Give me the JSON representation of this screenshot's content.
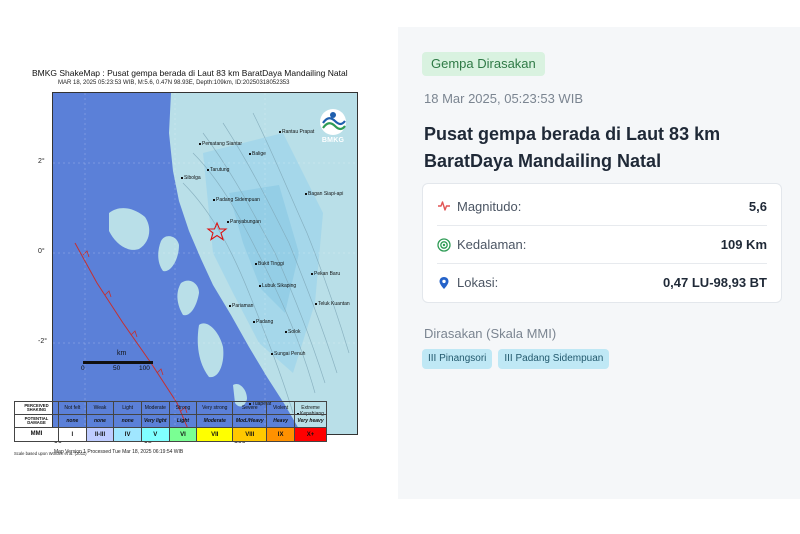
{
  "map": {
    "title": "BMKG ShakeMap : Pusat gempa berada di Laut 83 km BaratDaya Mandailing Natal",
    "subtitle": "MAR 18, 2025 05:23:53 WIB, M:5.6, 0.47N 98.93E, Depth:109km, ID:20250318052353",
    "lat_labels": [
      "2°",
      "0°",
      "-2°"
    ],
    "lon_labels": [
      "96°",
      "98°",
      "100°"
    ],
    "scale_title": "km",
    "scale_ticks": [
      "0",
      "50",
      "100"
    ],
    "logo_text": "BMKG",
    "version_note": "Map Version 1 Processed Tue Mar 18, 2025 06:19:54 WIB",
    "scale_note": "Scale based upon Worden et al. (2011)",
    "places": [
      "Pematang Siantar",
      "Balige",
      "Bagan Siapi-api",
      "Sibolga",
      "Padang Sidempuan",
      "Panyabungan",
      "Bukit Tinggi",
      "Pekan Baru",
      "Lubuk Sikaping",
      "Teluk Kuantan",
      "Padang",
      "Sungai Penuh",
      "Solok",
      "Pariaman",
      "Kepahiang",
      "Tuapejat",
      "Tarutung",
      "Rantau Prapat"
    ],
    "legend": {
      "headers": [
        "PERCEIVED SHAKING",
        "Not felt",
        "Weak",
        "Light",
        "Moderate",
        "Strong",
        "Very strong",
        "Severe",
        "Violent",
        "Extreme"
      ],
      "damage": [
        "POTENTIAL DAMAGE",
        "none",
        "none",
        "none",
        "Very light",
        "Light",
        "Moderate",
        "Mod./Heavy",
        "Heavy",
        "Very heavy"
      ],
      "mmi": [
        "MMI",
        "I",
        "II-III",
        "IV",
        "V",
        "VI",
        "VII",
        "VIII",
        "IX",
        "X+"
      ],
      "mmi_colors": [
        "#ffffff",
        "#ffffff",
        "#bfccff",
        "#a0e6ff",
        "#80ffff",
        "#7aff93",
        "#ffff00",
        "#ffc800",
        "#ff9100",
        "#ff0000",
        "#c80000"
      ]
    }
  },
  "event": {
    "badge": "Gempa Dirasakan",
    "timestamp": "18 Mar 2025, 05:23:53 WIB",
    "headline": "Pusat gempa berada di Laut 83 km BaratDaya Mandailing Natal",
    "rows": [
      {
        "label": "Magnitudo:",
        "value": "5,6",
        "icon": "activity-icon"
      },
      {
        "label": "Kedalaman:",
        "value": "109 Km",
        "icon": "target-icon"
      },
      {
        "label": "Lokasi:",
        "value": "0,47 LU-98,93 BT",
        "icon": "location-pin-icon"
      }
    ],
    "felt_title": "Dirasakan (Skala MMI)",
    "felt": [
      "III Pinangsori",
      "III Padang Sidempuan"
    ],
    "colors": {
      "badge_bg": "#d9f2e0",
      "badge_fg": "#2f7a46",
      "chip_bg": "#bfe8f5",
      "panel_bg": "#f5f7f9",
      "icon_red": "#e25555",
      "icon_green": "#2e9b55",
      "icon_blue": "#2563c9"
    }
  }
}
